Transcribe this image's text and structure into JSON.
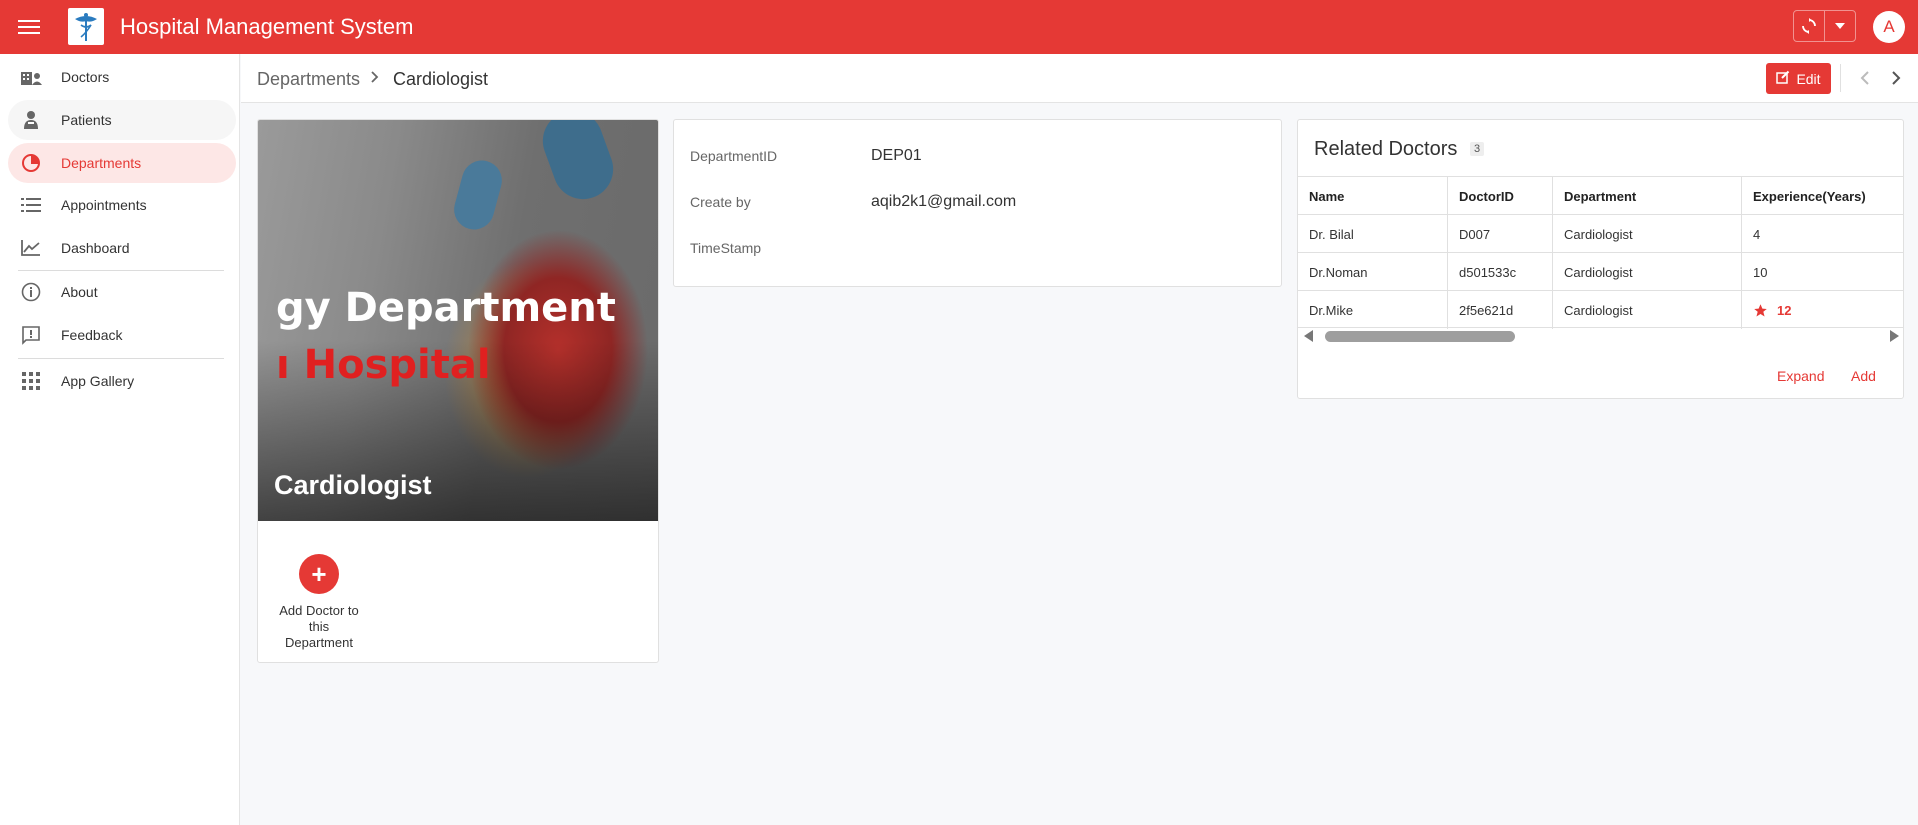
{
  "app": {
    "title": "Hospital Management System",
    "avatar_letter": "A"
  },
  "sidebar": {
    "items": [
      {
        "label": "Doctors",
        "icon": "hospital-building-icon"
      },
      {
        "label": "Patients",
        "icon": "patient-icon"
      },
      {
        "label": "Departments",
        "icon": "pie-chart-icon"
      },
      {
        "label": "Appointments",
        "icon": "list-icon"
      },
      {
        "label": "Dashboard",
        "icon": "trend-chart-icon"
      },
      {
        "label": "About",
        "icon": "info-icon"
      },
      {
        "label": "Feedback",
        "icon": "feedback-icon"
      },
      {
        "label": "App Gallery",
        "icon": "grid-apps-icon"
      }
    ]
  },
  "breadcrumb": {
    "root": "Departments",
    "current": "Cardiologist"
  },
  "toolbar": {
    "edit_label": "Edit"
  },
  "image_card": {
    "banner_line1": "gy Department",
    "banner_line2": "ı Hospital",
    "caption": "Cardiologist",
    "add_doctor_label": "Add Doctor to this Department"
  },
  "details": {
    "department_id_label": "DepartmentID",
    "department_id_value": "DEP01",
    "created_by_label": "Create by",
    "created_by_value": "aqib2k1@gmail.com",
    "timestamp_label": "TimeStamp",
    "timestamp_value": ""
  },
  "related": {
    "title": "Related Doctors",
    "count": "3",
    "columns": [
      "Name",
      "DoctorID",
      "Department",
      "Experience(Years)"
    ],
    "rows": [
      {
        "name": "Dr. Bilal",
        "id": "D007",
        "dept": "Cardiologist",
        "exp": "4"
      },
      {
        "name": "Dr.Noman",
        "id": "d501533c",
        "dept": "Cardiologist",
        "exp": "10"
      },
      {
        "name": "Dr.Mike",
        "id": "2f5e621d",
        "dept": "Cardiologist",
        "exp": "12"
      }
    ],
    "expand_label": "Expand",
    "add_label": "Add"
  },
  "colors": {
    "brand": "#e53935",
    "active_bg": "#fde7e6"
  }
}
